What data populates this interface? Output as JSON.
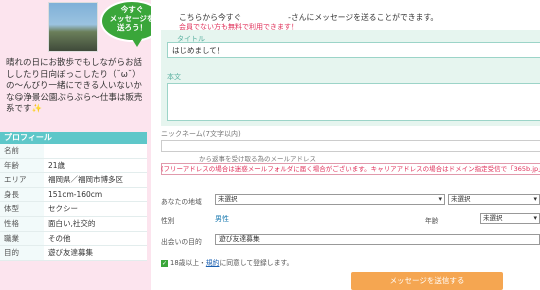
{
  "bubble": {
    "text": "今すぐ\nメッセージを\n送ろう！"
  },
  "bio": "晴れの日にお散歩でもしながらお話ししたり日向ぼっこしたり（˘ω˘）の～んびり一緒にできる人いないかな😋浄景公園ぶらぶら〜仕事は販売系です✨",
  "profile": {
    "header": "プロフィール",
    "rows": [
      {
        "k": "名前",
        "v": ""
      },
      {
        "k": "年齢",
        "v": "21歳"
      },
      {
        "k": "エリア",
        "v": "福岡県／福岡市博多区"
      },
      {
        "k": "身長",
        "v": "151cm-160cm"
      },
      {
        "k": "体型",
        "v": "セクシー"
      },
      {
        "k": "性格",
        "v": "面白い,社交的"
      },
      {
        "k": "職業",
        "v": "その他"
      },
      {
        "k": "目的",
        "v": "遊び友達募集"
      }
    ]
  },
  "form": {
    "intro": "こちらから今すぐ　　　　　　-さんにメッセージを送ることができます。",
    "free_note": "会員でない方も無料で利用できます！",
    "title_label": "タイトル",
    "title_value": "はじめまして！",
    "body_label": "本文",
    "nick_label": "ニックネーム(7文字以内)",
    "mail_label": "から返事を受け取る為のメールアドレス",
    "mail_note": "(フリーアドレスの場合は迷惑メールフォルダに届く場合がございます。キャリアアドレスの場合はドメイン指定受信で「365b.jp」を",
    "area_label": "あなたの地域",
    "area_select1": "未選択",
    "area_select2": "未選択",
    "gender_label": "性別",
    "gender_value": "男性",
    "age_label": "年齢",
    "age_select": "未選択",
    "purpose_label": "出会いの目的",
    "purpose_value": "遊び友達募集",
    "agree_pre": "18歳以上・",
    "agree_link": "規約",
    "agree_post": "に同意して登録します。",
    "send": "メッセージを送信する"
  },
  "colors": {
    "accent": "#5ec7c9",
    "bubble": "#3aa63a",
    "send": "#f5a651",
    "warn": "#e0305a"
  }
}
